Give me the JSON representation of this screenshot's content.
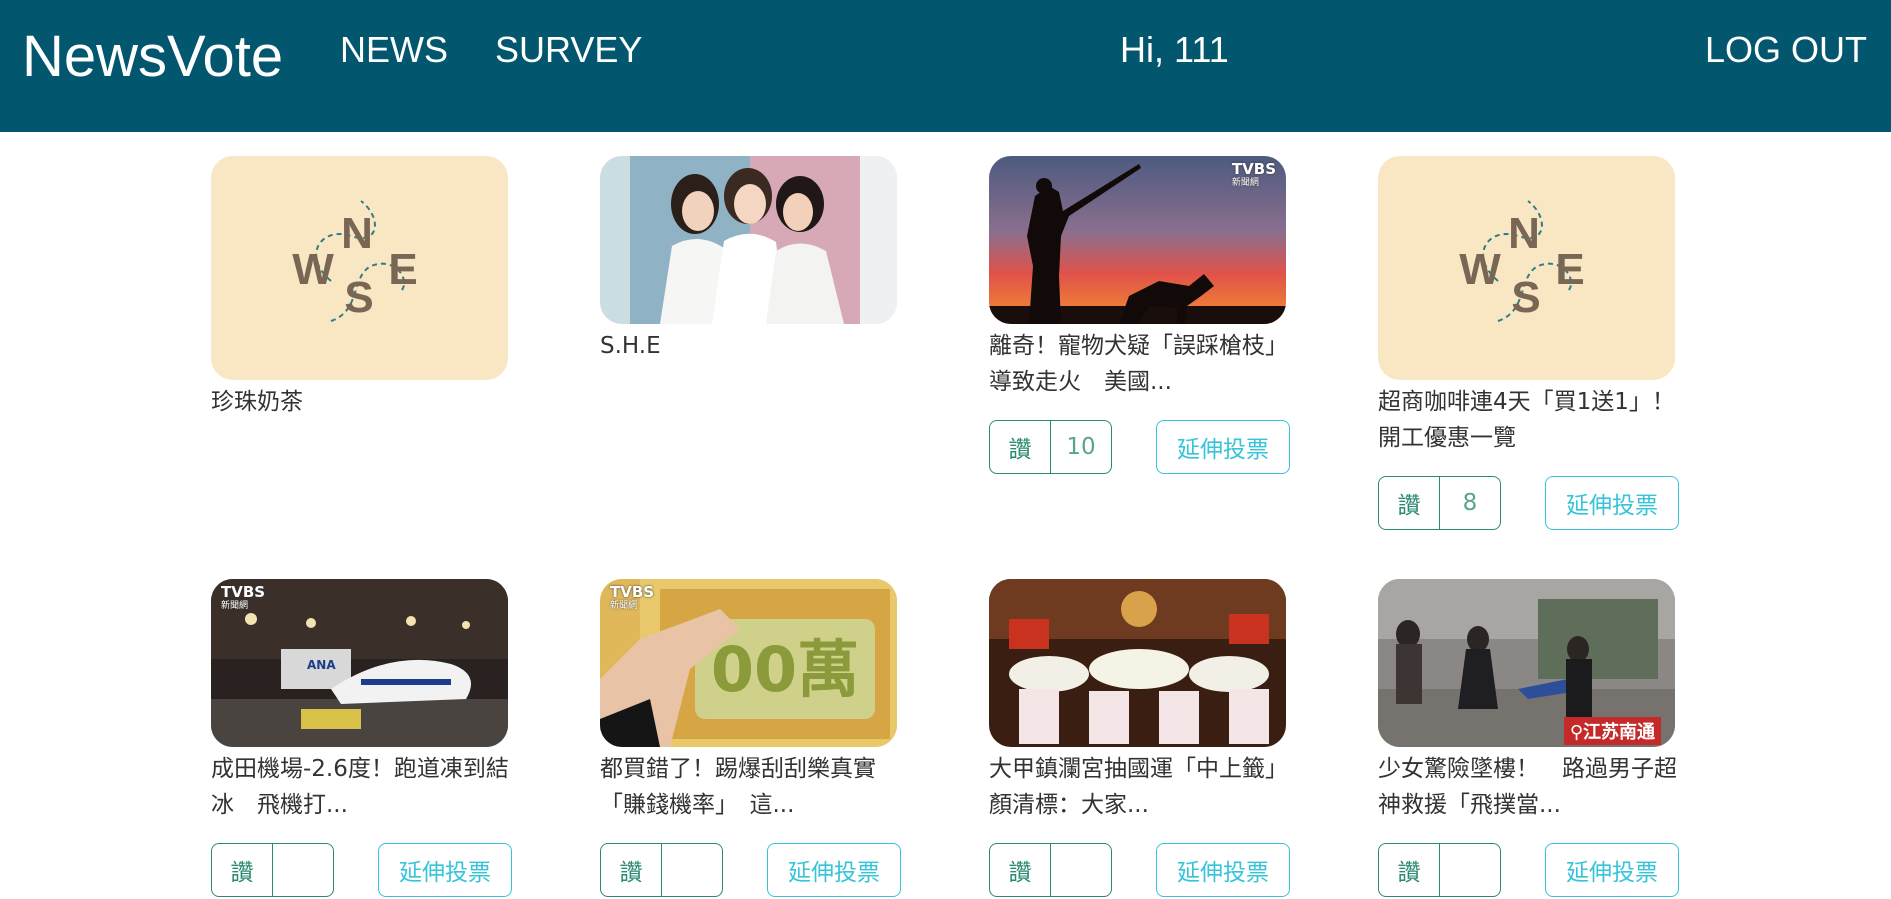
{
  "header": {
    "brand": "NewsVote",
    "nav": [
      "NEWS",
      "SURVEY"
    ],
    "greeting": "Hi, 111",
    "logout": "LOG OUT"
  },
  "colors": {
    "navbar": "#02566e",
    "like_border": "#2a8a72",
    "extend_border": "#36c4d9",
    "placeholder_bg": "#f9e7c3"
  },
  "cards": [
    {
      "title": "珍珠奶茶",
      "image": "compass-placeholder"
    },
    {
      "title": "S.H.E",
      "image": "group-photo"
    },
    {
      "title": "離奇！寵物犬疑「誤踩槍枝」導致走火　美國...",
      "image": "hunter-silhouette",
      "like_label": "讚",
      "likes": "10",
      "extend_label": "延伸投票",
      "watermark": "TVBS"
    },
    {
      "title": "超商咖啡連4天「買1送1」！開工優惠一覽",
      "image": "compass-placeholder",
      "like_label": "讚",
      "likes": "8",
      "extend_label": "延伸投票"
    },
    {
      "title": "成田機場-2.6度！跑道凍到結冰　飛機打...",
      "image": "airport-night",
      "like_label": "讚",
      "likes": "",
      "extend_label": "延伸投票",
      "watermark": "TVBS"
    },
    {
      "title": "都買錯了！踢爆刮刮樂真實「賺錢機率」　這...",
      "image": "lottery-ticket",
      "like_label": "讚",
      "likes": "",
      "extend_label": "延伸投票",
      "watermark": "TVBS",
      "ticket_text": "00萬"
    },
    {
      "title": "大甲鎮瀾宮抽國運「中上籤」　顏清標：大家...",
      "image": "temple-altar",
      "like_label": "讚",
      "likes": "",
      "extend_label": "延伸投票"
    },
    {
      "title": "少女驚險墜樓！　路過男子超神救援「飛撲當...",
      "image": "street-scene",
      "like_label": "讚",
      "likes": "",
      "extend_label": "延伸投票",
      "location_tag": "江苏南通"
    }
  ],
  "watermark_sub": "新聞網"
}
